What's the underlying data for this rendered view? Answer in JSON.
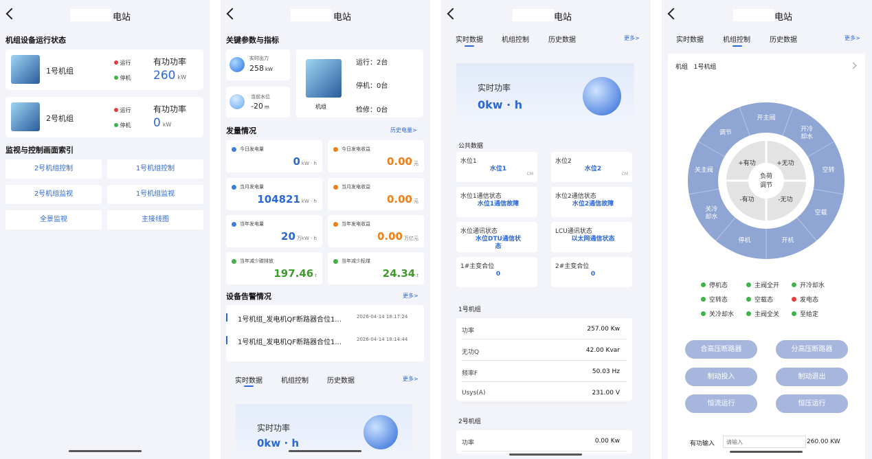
{
  "title": "电站",
  "p1": {
    "section1": "机组设备运行状态",
    "units": [
      {
        "name": "1号机组",
        "run": "运行",
        "stop": "停机",
        "power_label": "有功功率",
        "power": "260",
        "unit": "kW"
      },
      {
        "name": "2号机组",
        "run": "运行",
        "stop": "停机",
        "power_label": "有功功率",
        "power": "0",
        "unit": "kW"
      }
    ],
    "section2": "监视与控制画面索引",
    "links": [
      "2号机组控制",
      "1号机组控制",
      "2号机组监视",
      "1号机组监视",
      "全景监视",
      "主接线图"
    ]
  },
  "p2": {
    "section1": "关键参数与指标",
    "realtime_label": "实时出力",
    "realtime_value": "258",
    "realtime_unit": "kW",
    "water_label": "当前水位",
    "water_value": "-20",
    "water_unit": "m",
    "unit_label": "机组",
    "running": "运行：2台",
    "stopped": "停机：0台",
    "repair": "检修：0台",
    "section2": "发量情况",
    "history_link": "历史电量>",
    "stats": [
      {
        "label": "今日发电量",
        "value": "0",
        "unit": "kW · h",
        "color": "#2c67d6",
        "icon": "#3a7ce0"
      },
      {
        "label": "今日发电收益",
        "value": "0.00",
        "unit": "元",
        "color": "#f07f1a",
        "icon": "#f07f1a"
      },
      {
        "label": "当月发电量",
        "value": "104821",
        "unit": "kW · h",
        "color": "#2c67d6",
        "icon": "#3a7ce0"
      },
      {
        "label": "当月发电收益",
        "value": "0.00",
        "unit": "元",
        "color": "#f07f1a",
        "icon": "#f07f1a"
      },
      {
        "label": "当年发电量",
        "value": "20",
        "unit": "万kW · h",
        "color": "#2c67d6",
        "icon": "#3a7ce0"
      },
      {
        "label": "当年发电收益",
        "value": "0.00",
        "unit": "万亿元",
        "color": "#f07f1a",
        "icon": "#f07f1a"
      },
      {
        "label": "当年减少碳排放",
        "value": "197.46",
        "unit": "t",
        "color": "#3f9b2c",
        "icon": "#3fb24a"
      },
      {
        "label": "当年减少标煤",
        "value": "24.34",
        "unit": "t",
        "color": "#3f9b2c",
        "icon": "#3fb24a"
      }
    ],
    "section3": "设备告警情况",
    "more": "更多>",
    "alarms": [
      {
        "text": "1号机组_发电机QF断路器合位1...",
        "time": "2026-04-14 18:17:24"
      },
      {
        "text": "1号机组_发电机QF断路器合位1...",
        "time": "2026-04-14 18:14:44"
      }
    ],
    "tabs": [
      "实时数据",
      "机组控制",
      "历史数据"
    ],
    "banner_label": "实时功率",
    "banner_value": "0kw · h"
  },
  "p3": {
    "tabs": [
      "实时数据",
      "机组控制",
      "历史数据"
    ],
    "more": "更多>",
    "banner_label": "实时功率",
    "banner_value": "0kw · h",
    "public_label": "公共数据",
    "cells": [
      {
        "label": "水位1",
        "value": "水位1",
        "unit": "CM"
      },
      {
        "label": "水位2",
        "value": "水位2",
        "unit": "CM"
      },
      {
        "label": "水位1通信状态",
        "value": "水位1通信故障",
        "unit": ""
      },
      {
        "label": "水位2通信状态",
        "value": "水位2通信故障",
        "unit": ""
      },
      {
        "label": "水位通讯状态",
        "value": "水位DTU通信状态",
        "unit": ""
      },
      {
        "label": "LCU通讯状态",
        "value": "以太网通信状态",
        "unit": ""
      },
      {
        "label": "1#主变合位",
        "value": "0",
        "unit": ""
      },
      {
        "label": "2#主变合位",
        "value": "0",
        "unit": ""
      }
    ],
    "unit1_label": "1号机组",
    "unit1_rows": [
      {
        "k": "功率",
        "v": "257.00 Kw"
      },
      {
        "k": "无功Q",
        "v": "42.00 Kvar"
      },
      {
        "k": "频率F",
        "v": "50.03 Hz"
      },
      {
        "k": "Usys(A)",
        "v": "231.00 V"
      }
    ],
    "unit2_label": "2号机组",
    "unit2_rows": [
      {
        "k": "功率",
        "v": "0.00 Kw"
      }
    ]
  },
  "p4": {
    "tabs": [
      "实时数据",
      "机组控制",
      "历史数据"
    ],
    "more": "更多>",
    "selector_label": "机组",
    "selector_value": "1号机组",
    "dial_center": "负荷调节",
    "dial_inner": [
      "+有功",
      "+无功",
      "-有功",
      "-无功"
    ],
    "dial_outer": [
      "开主阀",
      "开冷却水",
      "空转",
      "空载",
      "开机",
      "停机",
      "关冷却水",
      "关主阀",
      "调节"
    ],
    "legend": [
      {
        "label": "停机态",
        "color": "#3fb24a"
      },
      {
        "label": "主阀全开",
        "color": "#3fb24a"
      },
      {
        "label": "开冷却水",
        "color": "#3fb24a"
      },
      {
        "label": "空转态",
        "color": "#3fb24a"
      },
      {
        "label": "空载态",
        "color": "#3fb24a"
      },
      {
        "label": "发电态",
        "color": "#e43b3b"
      },
      {
        "label": "关冷却水",
        "color": "#3fb24a"
      },
      {
        "label": "主阀全关",
        "color": "#3fb24a"
      },
      {
        "label": "至给定",
        "color": "#3fb24a"
      }
    ],
    "buttons": [
      "合高压断路器",
      "分高压断路器",
      "制动投入",
      "制动退出",
      "恒流运行",
      "恒压运行"
    ],
    "input_label": "有功输入",
    "input_placeholder": "请输入",
    "input_value": "260.00 KW"
  }
}
